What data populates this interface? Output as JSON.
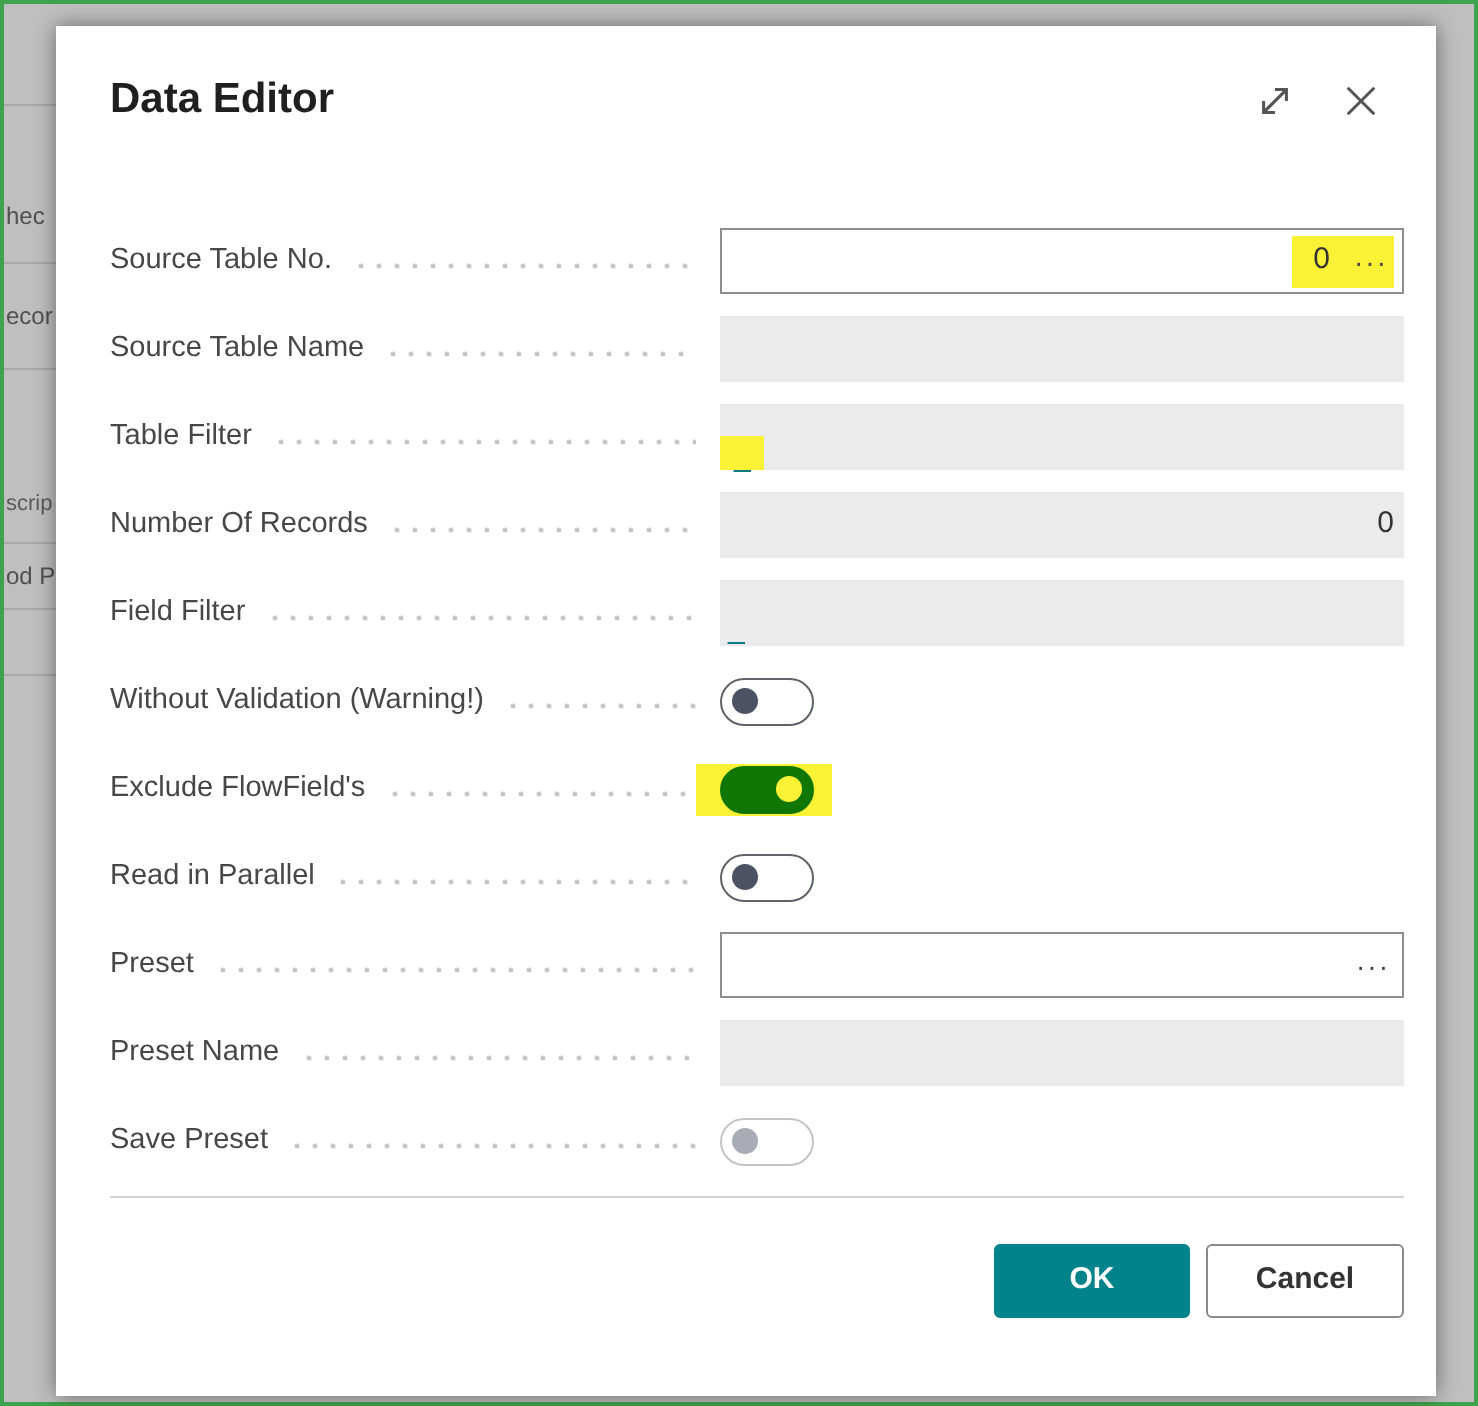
{
  "background_page": {
    "rows": [
      {
        "text": "hec",
        "kind": "cell"
      },
      {
        "text": "ecor",
        "kind": "cell"
      },
      {
        "text": "scrip",
        "kind": "header"
      },
      {
        "text": "od P",
        "kind": "cell"
      }
    ]
  },
  "dialog": {
    "title": "Data Editor",
    "fields": [
      {
        "label": "Source Table No.",
        "kind": "lookup",
        "value": "0",
        "assist": "···",
        "highlighted": true
      },
      {
        "label": "Source Table Name",
        "kind": "display",
        "highlighted": false
      },
      {
        "label": "Table Filter",
        "kind": "drilldown",
        "value": "_",
        "highlighted": true
      },
      {
        "label": "Number Of Records",
        "kind": "display",
        "value": "0",
        "highlighted": false
      },
      {
        "label": "Field Filter",
        "kind": "drilldown",
        "value": "_",
        "highlighted": false
      },
      {
        "label": "Without Validation (Warning!)",
        "kind": "toggle",
        "on": false,
        "disabled": false,
        "highlighted": false
      },
      {
        "label": "Exclude FlowField's",
        "kind": "toggle",
        "on": true,
        "disabled": false,
        "highlighted": true
      },
      {
        "label": "Read in Parallel",
        "kind": "toggle",
        "on": false,
        "disabled": false,
        "highlighted": false
      },
      {
        "label": "Preset",
        "kind": "lookup",
        "assist": "···",
        "highlighted": false
      },
      {
        "label": "Preset Name",
        "kind": "display",
        "highlighted": false
      },
      {
        "label": "Save Preset",
        "kind": "toggle",
        "on": false,
        "disabled": true,
        "highlighted": false
      }
    ],
    "buttons": [
      {
        "label": "OK",
        "kind": "primary"
      },
      {
        "label": "Cancel",
        "kind": "secondary"
      }
    ]
  }
}
